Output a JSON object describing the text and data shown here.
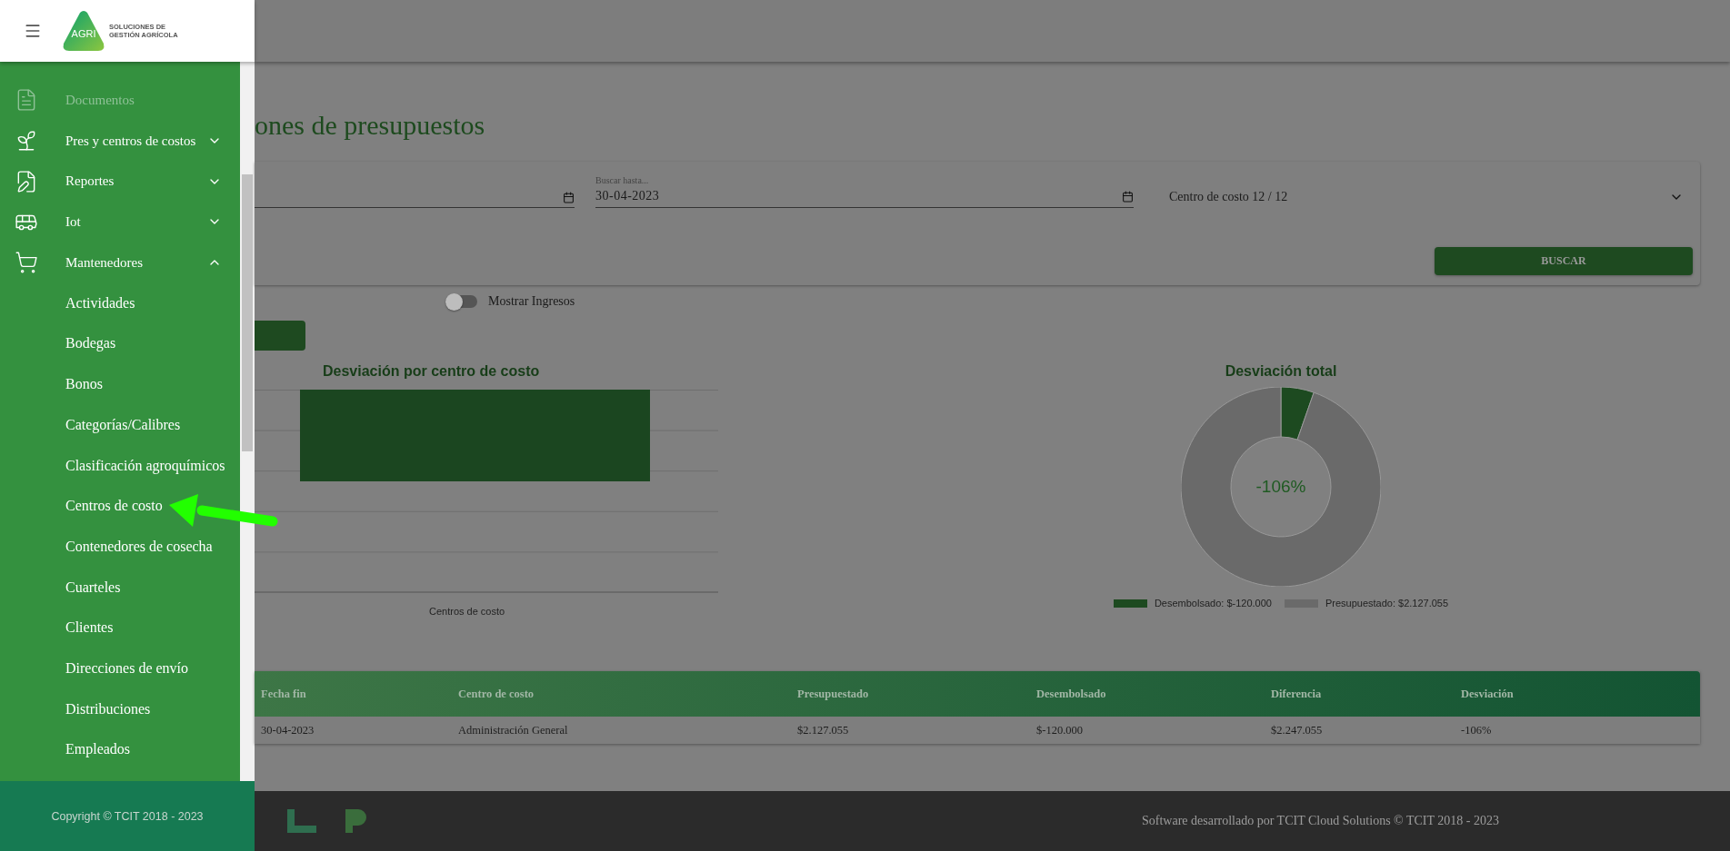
{
  "sidebar": {
    "logo": {
      "mark": "AGRI",
      "tagline": [
        "SOLUCIONES DE",
        "GESTIÓN AGRÍCOLA"
      ]
    },
    "items": [
      {
        "kind": "link",
        "label": "Documentos",
        "disabled": true
      },
      {
        "kind": "group",
        "label": "Pres y centros de costos",
        "disabled": false,
        "expanded": false
      },
      {
        "kind": "group",
        "label": "Reportes",
        "disabled": false,
        "expanded": false
      },
      {
        "kind": "group",
        "label": "Iot",
        "disabled": false,
        "expanded": false
      },
      {
        "kind": "group",
        "label": "Mantenedores",
        "disabled": false,
        "expanded": true,
        "children": [
          "Actividades",
          "Bodegas",
          "Bonos",
          "Categorías/Calibres",
          "Clasificación agroquímicos",
          "Centros de costo",
          "Contenedores de cosecha",
          "Cuarteles",
          "Clientes",
          "Direcciones de envío",
          "Distribuciones",
          "Empleados"
        ]
      }
    ],
    "copyright": "Copyright © TCIT 2018 - 2023"
  },
  "page": {
    "title": "ones de presupuestos",
    "date_to": {
      "label": "Buscar hasta...",
      "value": "30-04-2023"
    },
    "cost_center": "Centro de costo 12 / 12",
    "search_button": "BUSCAR",
    "toggle": {
      "label": "Mostrar Ingresos",
      "on": false
    },
    "bar_chart": {
      "title": "Desviación por centro de costo",
      "xlabel": "Centros de costo"
    },
    "donut": {
      "center_label": "-106%",
      "chart_data": {
        "type": "donut",
        "title": "Desviación total",
        "categories": [
          "Desembolsado: $-120.000",
          "Presupuestado: $2.127.055"
        ],
        "values": [
          5.34,
          94.66
        ]
      }
    },
    "table": {
      "columns": [
        "Fecha fin",
        "Centro de costo",
        "Presupuestado",
        "Desembolsado",
        "Diferencia",
        "Desviación"
      ],
      "rows": [
        [
          "30-04-2023",
          "Administración General",
          "$2.127.055",
          "$-120.000",
          "$2.247.055",
          "-106%"
        ]
      ]
    }
  },
  "footer": {
    "text": "Software desarrollado por TCIT Cloud Solutions © TCIT 2018 - 2023"
  }
}
